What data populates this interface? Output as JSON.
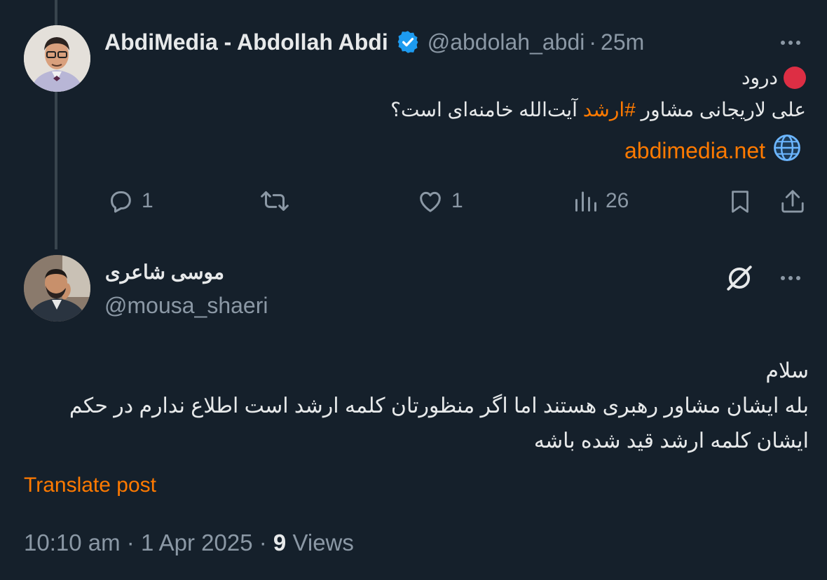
{
  "post": {
    "display_name": "AbdiMedia - Abdollah Abdi",
    "handle": "@abdolah_abdi",
    "separator": "·",
    "time": "25m",
    "line1": "درود",
    "line2_before": "علی لاریجانی مشاور ",
    "hashtag": "#ارشد",
    "line2_after": " آیت‌الله خامنه‌ای است؟",
    "link": "abdimedia.net",
    "actions": {
      "replies": "1",
      "likes": "1",
      "views": "26"
    }
  },
  "reply": {
    "display_name": "موسی شاعری",
    "handle": "@mousa_shaeri",
    "body_lines": [
      "سلام",
      "بله ایشان مشاور رهبری هستند اما اگر منظورتان کلمه ارشد است اطلاع ندارم در حکم",
      "ایشان کلمه ارشد قید شده باشه"
    ],
    "translate_label": "Translate post",
    "timestamp": "10:10 am",
    "date": "1 Apr 2025",
    "separator": "·",
    "views_count": "9",
    "views_label": "Views"
  },
  "colors": {
    "background": "#15202b",
    "accent": "#ff7a00",
    "verified": "#1d9bf0",
    "muted": "#8b98a5",
    "red_dot": "#dd2e44"
  },
  "icons": [
    "verified-badge-icon",
    "more-icon",
    "red-circle-icon",
    "globe-icon",
    "reply-icon",
    "retweet-icon",
    "like-icon",
    "views-icon",
    "bookmark-icon",
    "share-icon",
    "grok-icon"
  ]
}
